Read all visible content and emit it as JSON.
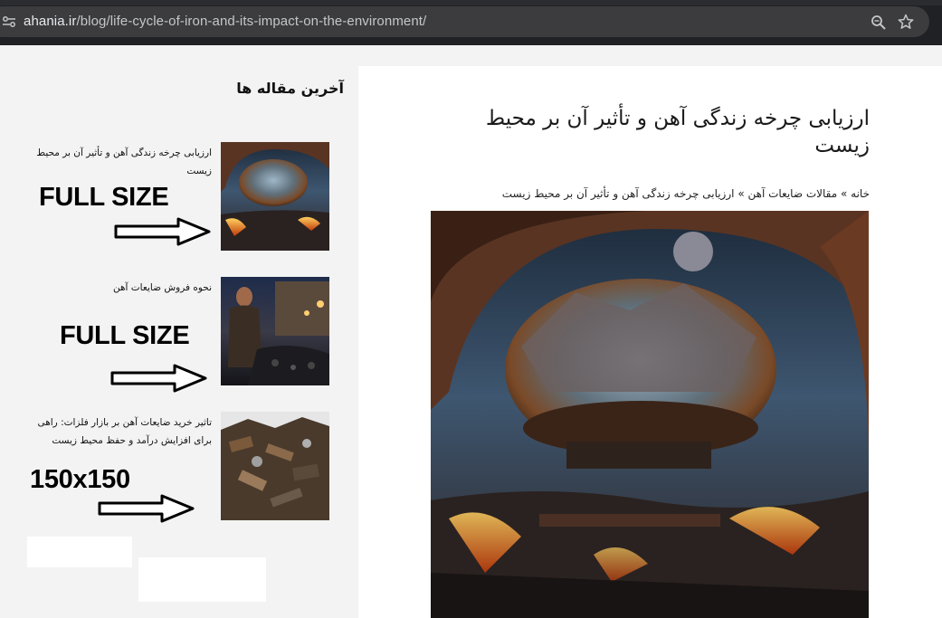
{
  "browser": {
    "url_host": "ahania.ir",
    "url_path": "/blog/life-cycle-of-iron-and-its-impact-on-the-environment/",
    "icons": [
      "site-info-icon",
      "zoom-icon",
      "bookmark-star-icon"
    ]
  },
  "sidebar": {
    "title": "آخرین مقاله ها",
    "posts": [
      {
        "title": "ارزیابی چرخه زندگی آهن و تأثیر آن بر محیط زیست",
        "annotation": "FULL SIZE"
      },
      {
        "title": "نحوه فروش ضایعات آهن",
        "annotation": "FULL SIZE"
      },
      {
        "title": "تاثیر خرید ضایعات آهن بر بازار فلزات: راهی برای افزایش درآمد و حفظ محیط زیست",
        "annotation": "150x150"
      }
    ]
  },
  "article": {
    "title": "ارزیابی چرخه زندگی آهن و تأثیر آن بر محیط زیست",
    "breadcrumb": {
      "home": "خانه",
      "sep": "»",
      "category": "مقالات ضایعات آهن",
      "current": "ارزیابی چرخه زندگی آهن و تأثیر آن بر محیط زیست"
    }
  },
  "colors": {
    "chrome_bg": "#202124",
    "omnibox_bg": "#3c3c3f",
    "page_bg": "#f3f3f3",
    "card_bg": "#ffffff"
  }
}
